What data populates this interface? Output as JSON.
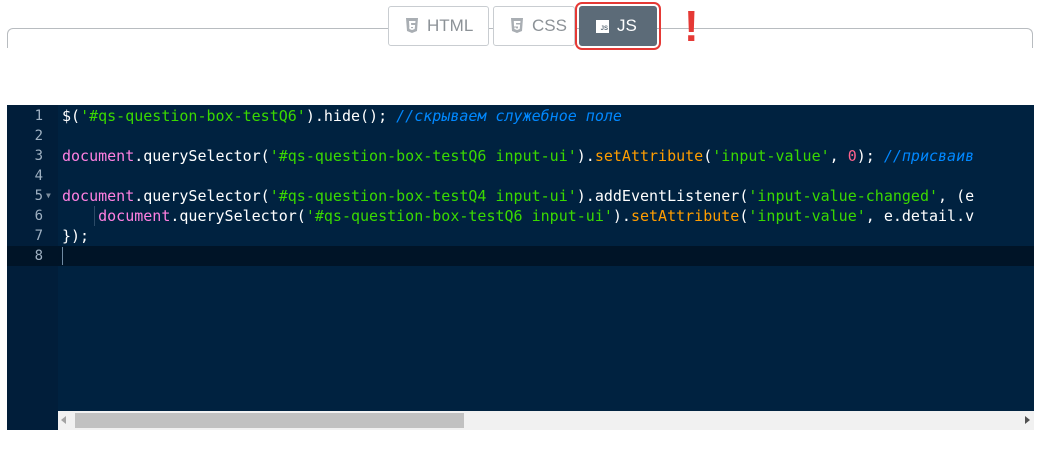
{
  "tabs": {
    "html_label": "HTML",
    "css_label": "CSS",
    "js_label": "JS",
    "js_badge": "JS",
    "active": "JS"
  },
  "annotation": {
    "mark": "!"
  },
  "colors": {
    "editor_bg": "#002240",
    "active_tab_bg": "#5c6b78",
    "highlight_border": "#e53935",
    "string": "#3ad900",
    "comment": "#0088ff",
    "method": "#ff9d00",
    "object": "#ff80e1",
    "number": "#ff628c"
  },
  "editor": {
    "lines": [
      {
        "num": "1",
        "tokens": [
          {
            "t": "pl",
            "v": "$("
          },
          {
            "t": "str",
            "v": "'#qs-question-box-testQ6'"
          },
          {
            "t": "pl",
            "v": ").hide(); "
          },
          {
            "t": "com",
            "v": "//скрываем служебное поле"
          }
        ]
      },
      {
        "num": "2",
        "tokens": []
      },
      {
        "num": "3",
        "tokens": [
          {
            "t": "obj",
            "v": "document"
          },
          {
            "t": "pl",
            "v": ".querySelector("
          },
          {
            "t": "str",
            "v": "'#qs-question-box-testQ6 input-ui'"
          },
          {
            "t": "pl",
            "v": ")."
          },
          {
            "t": "ident",
            "v": "setAttribute"
          },
          {
            "t": "pl",
            "v": "("
          },
          {
            "t": "str",
            "v": "'input-value'"
          },
          {
            "t": "pl",
            "v": ", "
          },
          {
            "t": "num",
            "v": "0"
          },
          {
            "t": "pl",
            "v": "); "
          },
          {
            "t": "com",
            "v": "//присваив"
          }
        ]
      },
      {
        "num": "4",
        "tokens": []
      },
      {
        "num": "5",
        "fold": true,
        "tokens": [
          {
            "t": "obj",
            "v": "document"
          },
          {
            "t": "pl",
            "v": ".querySelector("
          },
          {
            "t": "str",
            "v": "'#qs-question-box-testQ4 input-ui'"
          },
          {
            "t": "pl",
            "v": ").addEventListener("
          },
          {
            "t": "str",
            "v": "'input-value-changed'"
          },
          {
            "t": "pl",
            "v": ", (e"
          }
        ]
      },
      {
        "num": "6",
        "guide": true,
        "tokens": [
          {
            "t": "pl",
            "v": "    "
          },
          {
            "t": "obj",
            "v": "document"
          },
          {
            "t": "pl",
            "v": ".querySelector("
          },
          {
            "t": "str",
            "v": "'#qs-question-box-testQ6 input-ui'"
          },
          {
            "t": "pl",
            "v": ")."
          },
          {
            "t": "ident",
            "v": "setAttribute"
          },
          {
            "t": "pl",
            "v": "("
          },
          {
            "t": "str",
            "v": "'input-value'"
          },
          {
            "t": "pl",
            "v": ", e.detail.v"
          }
        ]
      },
      {
        "num": "7",
        "tokens": [
          {
            "t": "pl",
            "v": "});"
          }
        ]
      },
      {
        "num": "8",
        "active": true,
        "tokens": []
      }
    ]
  }
}
